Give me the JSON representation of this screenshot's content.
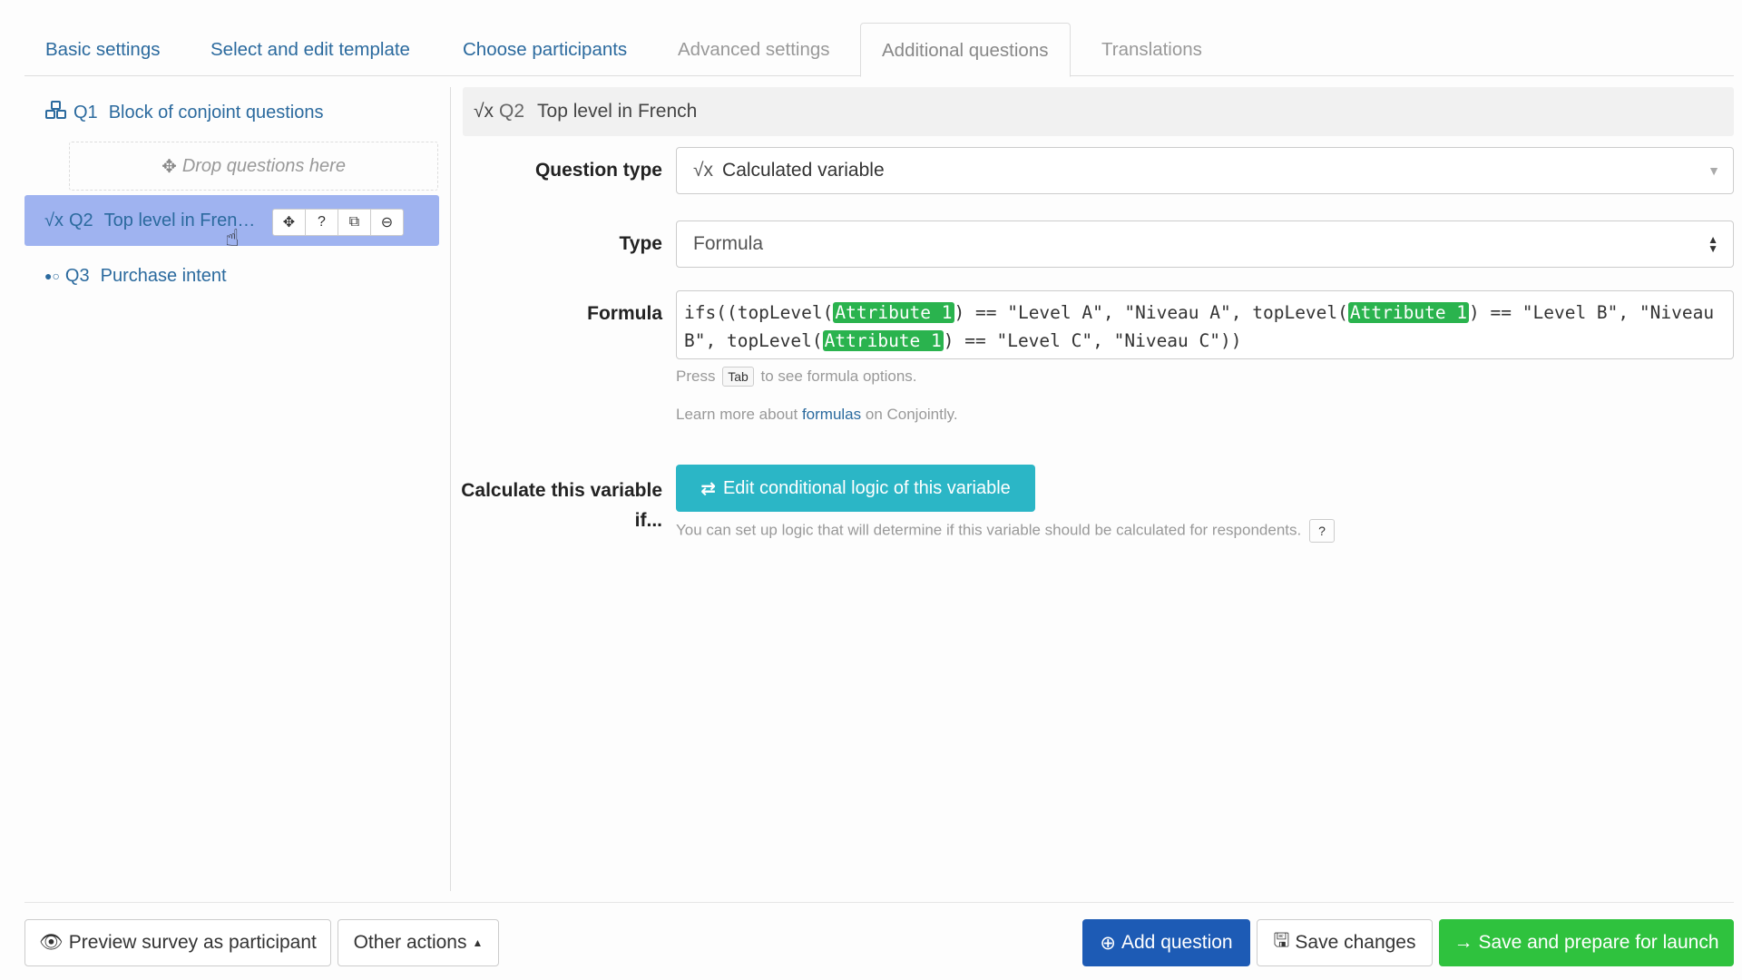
{
  "tabs": [
    {
      "label": "Basic settings"
    },
    {
      "label": "Select and edit template"
    },
    {
      "label": "Choose participants"
    },
    {
      "label": "Advanced settings"
    },
    {
      "label": "Additional questions"
    },
    {
      "label": "Translations"
    }
  ],
  "tree": {
    "q1": {
      "num": "Q1",
      "label": "Block of conjoint questions"
    },
    "drop_zone": "Drop questions here",
    "q2": {
      "num": "Q2",
      "label": "Top level in Fren…"
    },
    "q3": {
      "num": "Q3",
      "label": "Purchase intent"
    }
  },
  "panel": {
    "icon": "√x",
    "num": "Q2",
    "title": "Top level in French",
    "question_type_label": "Question type",
    "question_type_value": "Calculated variable",
    "type_label": "Type",
    "type_value": "Formula",
    "formula_label": "Formula",
    "formula": {
      "p1": "ifs((topLevel(",
      "attr": "Attribute 1",
      "p2": ") == \"Level A\", \"Niveau A\", topLevel(",
      "p3": ") == \"Level B\", \"Niveau B\", topLevel(",
      "p4": ") == \"Level C\", \"Niveau C\"))"
    },
    "help_press": "Press",
    "help_key": "Tab",
    "help_rest": "to see formula options.",
    "learn_pre": "Learn more about",
    "learn_link": "formulas",
    "learn_post": "on Conjointly.",
    "calc_label_1": "Calculate this variable",
    "calc_label_2": "if...",
    "logic_button": "Edit conditional logic of this variable",
    "logic_help": "You can set up logic that will determine if this variable should be calculated for respondents."
  },
  "footer": {
    "preview": "Preview survey as participant",
    "other": "Other actions",
    "add": "Add question",
    "save": "Save changes",
    "launch": "Save and prepare for launch"
  },
  "colors": {
    "selected": "#9fb3f0",
    "attr": "#2ab34e",
    "logic": "#2bb6c6",
    "primary": "#1d5bb5",
    "success": "#2fc23e"
  }
}
